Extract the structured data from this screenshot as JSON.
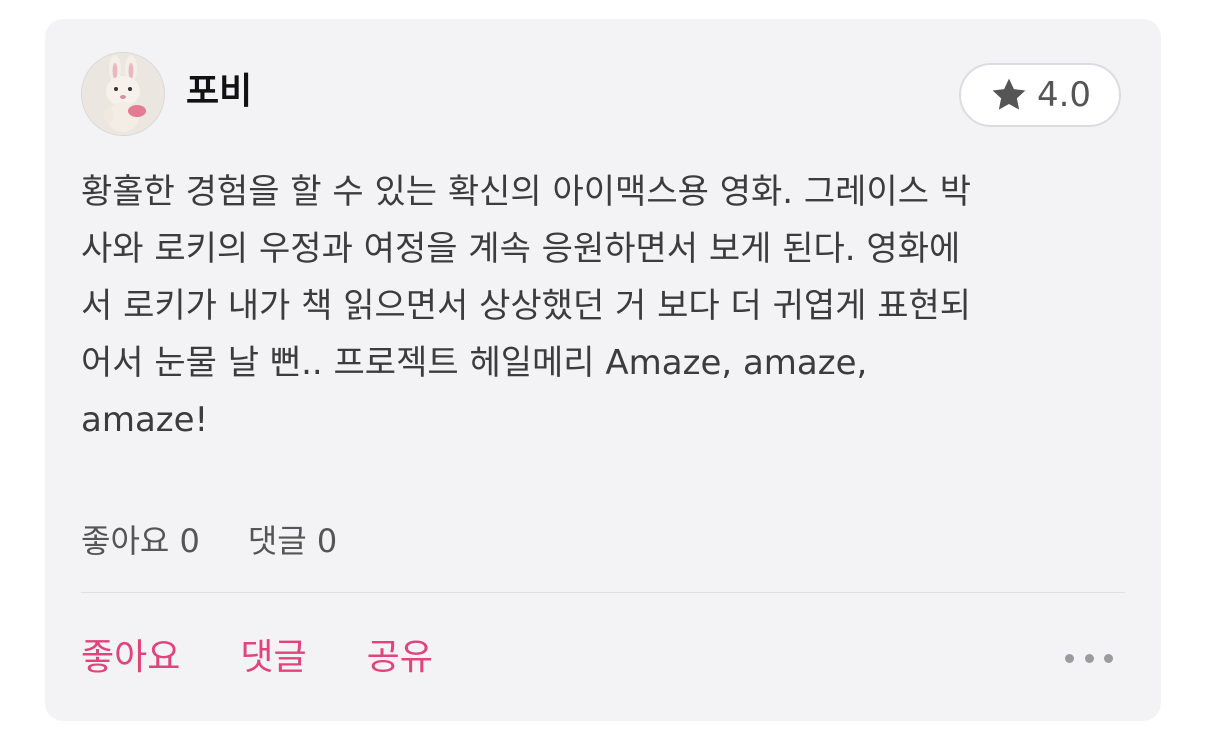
{
  "review": {
    "username": "포비",
    "rating": "4.0",
    "content": "황홀한 경험을 할 수 있는 확신의 아이맥스용 영화. 그레이스 박\n사와 로키의 우정과 여정을 계속 응원하면서 보게 된다. 영화에\n서 로키가 내가 책 읽으면서 상상했던 거 보다 더 귀엽게 표현되\n어서 눈물 날 뻔.. 프로젝트 헤일메리 Amaze, amaze,\namaze!",
    "likes_label": "좋아요 0",
    "comments_label": "댓글 0"
  },
  "actions": {
    "like": "좋아요",
    "comment": "댓글",
    "share": "공유"
  },
  "icons": {
    "rating": "star-icon",
    "more": "more-icon",
    "avatar": "plush-bunny-avatar"
  },
  "colors": {
    "accent": "#e0447a",
    "card_background": "#f3f3f5"
  }
}
